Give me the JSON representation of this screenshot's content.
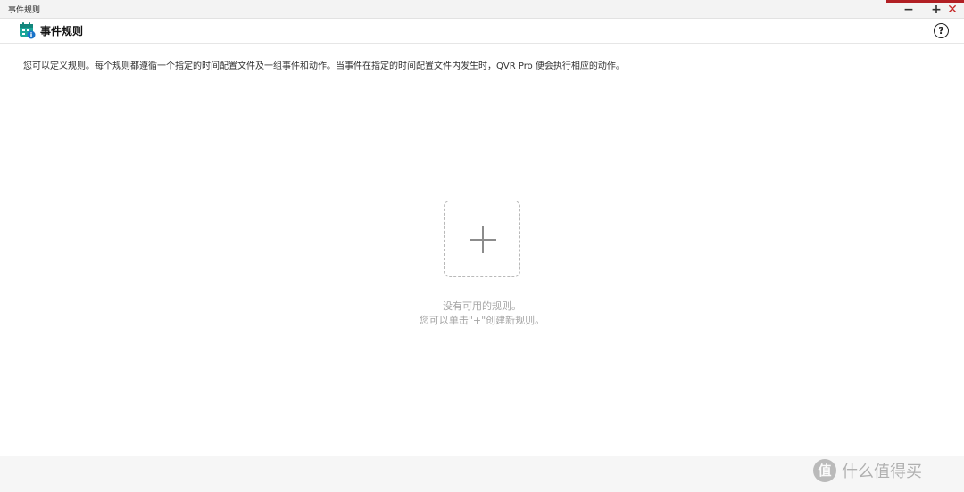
{
  "window": {
    "title": "事件规则",
    "minimize_icon": "−",
    "maximize_icon": "+",
    "close_icon": "✕",
    "accent_color": "#b11f24"
  },
  "header": {
    "title": "事件规则",
    "app_icon": "calendar-info-icon",
    "help_icon": "?"
  },
  "main": {
    "description": "您可以定义规则。每个规则都遵循一个指定的时间配置文件及一组事件和动作。当事件在指定的时间配置文件内发生时，QVR Pro 便会执行相应的动作。",
    "add_icon": "plus-icon",
    "empty_title": "没有可用的规则。",
    "empty_hint": "您可以单击\"+\"创建新规则。"
  },
  "watermark": {
    "badge": "值",
    "text": "什么值得买"
  }
}
